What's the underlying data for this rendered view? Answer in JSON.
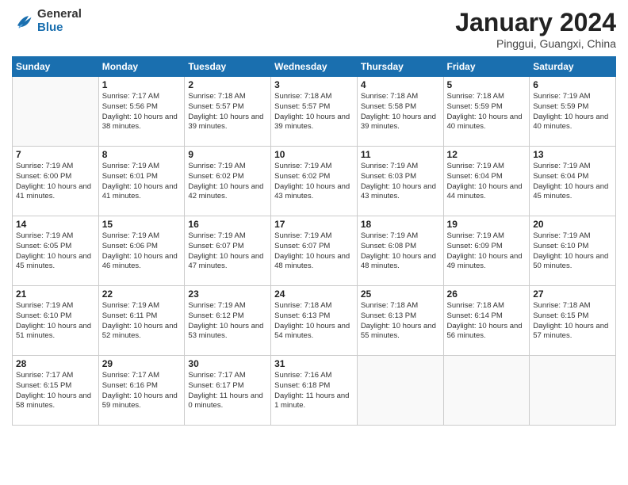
{
  "logo": {
    "general": "General",
    "blue": "Blue"
  },
  "title": {
    "month_year": "January 2024",
    "location": "Pinggui, Guangxi, China"
  },
  "weekdays": [
    "Sunday",
    "Monday",
    "Tuesday",
    "Wednesday",
    "Thursday",
    "Friday",
    "Saturday"
  ],
  "weeks": [
    [
      {
        "day": "",
        "info": ""
      },
      {
        "day": "1",
        "info": "Sunrise: 7:17 AM\nSunset: 5:56 PM\nDaylight: 10 hours\nand 38 minutes."
      },
      {
        "day": "2",
        "info": "Sunrise: 7:18 AM\nSunset: 5:57 PM\nDaylight: 10 hours\nand 39 minutes."
      },
      {
        "day": "3",
        "info": "Sunrise: 7:18 AM\nSunset: 5:57 PM\nDaylight: 10 hours\nand 39 minutes."
      },
      {
        "day": "4",
        "info": "Sunrise: 7:18 AM\nSunset: 5:58 PM\nDaylight: 10 hours\nand 39 minutes."
      },
      {
        "day": "5",
        "info": "Sunrise: 7:18 AM\nSunset: 5:59 PM\nDaylight: 10 hours\nand 40 minutes."
      },
      {
        "day": "6",
        "info": "Sunrise: 7:19 AM\nSunset: 5:59 PM\nDaylight: 10 hours\nand 40 minutes."
      }
    ],
    [
      {
        "day": "7",
        "info": "Sunrise: 7:19 AM\nSunset: 6:00 PM\nDaylight: 10 hours\nand 41 minutes."
      },
      {
        "day": "8",
        "info": "Sunrise: 7:19 AM\nSunset: 6:01 PM\nDaylight: 10 hours\nand 41 minutes."
      },
      {
        "day": "9",
        "info": "Sunrise: 7:19 AM\nSunset: 6:02 PM\nDaylight: 10 hours\nand 42 minutes."
      },
      {
        "day": "10",
        "info": "Sunrise: 7:19 AM\nSunset: 6:02 PM\nDaylight: 10 hours\nand 43 minutes."
      },
      {
        "day": "11",
        "info": "Sunrise: 7:19 AM\nSunset: 6:03 PM\nDaylight: 10 hours\nand 43 minutes."
      },
      {
        "day": "12",
        "info": "Sunrise: 7:19 AM\nSunset: 6:04 PM\nDaylight: 10 hours\nand 44 minutes."
      },
      {
        "day": "13",
        "info": "Sunrise: 7:19 AM\nSunset: 6:04 PM\nDaylight: 10 hours\nand 45 minutes."
      }
    ],
    [
      {
        "day": "14",
        "info": "Sunrise: 7:19 AM\nSunset: 6:05 PM\nDaylight: 10 hours\nand 45 minutes."
      },
      {
        "day": "15",
        "info": "Sunrise: 7:19 AM\nSunset: 6:06 PM\nDaylight: 10 hours\nand 46 minutes."
      },
      {
        "day": "16",
        "info": "Sunrise: 7:19 AM\nSunset: 6:07 PM\nDaylight: 10 hours\nand 47 minutes."
      },
      {
        "day": "17",
        "info": "Sunrise: 7:19 AM\nSunset: 6:07 PM\nDaylight: 10 hours\nand 48 minutes."
      },
      {
        "day": "18",
        "info": "Sunrise: 7:19 AM\nSunset: 6:08 PM\nDaylight: 10 hours\nand 48 minutes."
      },
      {
        "day": "19",
        "info": "Sunrise: 7:19 AM\nSunset: 6:09 PM\nDaylight: 10 hours\nand 49 minutes."
      },
      {
        "day": "20",
        "info": "Sunrise: 7:19 AM\nSunset: 6:10 PM\nDaylight: 10 hours\nand 50 minutes."
      }
    ],
    [
      {
        "day": "21",
        "info": "Sunrise: 7:19 AM\nSunset: 6:10 PM\nDaylight: 10 hours\nand 51 minutes."
      },
      {
        "day": "22",
        "info": "Sunrise: 7:19 AM\nSunset: 6:11 PM\nDaylight: 10 hours\nand 52 minutes."
      },
      {
        "day": "23",
        "info": "Sunrise: 7:19 AM\nSunset: 6:12 PM\nDaylight: 10 hours\nand 53 minutes."
      },
      {
        "day": "24",
        "info": "Sunrise: 7:18 AM\nSunset: 6:13 PM\nDaylight: 10 hours\nand 54 minutes."
      },
      {
        "day": "25",
        "info": "Sunrise: 7:18 AM\nSunset: 6:13 PM\nDaylight: 10 hours\nand 55 minutes."
      },
      {
        "day": "26",
        "info": "Sunrise: 7:18 AM\nSunset: 6:14 PM\nDaylight: 10 hours\nand 56 minutes."
      },
      {
        "day": "27",
        "info": "Sunrise: 7:18 AM\nSunset: 6:15 PM\nDaylight: 10 hours\nand 57 minutes."
      }
    ],
    [
      {
        "day": "28",
        "info": "Sunrise: 7:17 AM\nSunset: 6:15 PM\nDaylight: 10 hours\nand 58 minutes."
      },
      {
        "day": "29",
        "info": "Sunrise: 7:17 AM\nSunset: 6:16 PM\nDaylight: 10 hours\nand 59 minutes."
      },
      {
        "day": "30",
        "info": "Sunrise: 7:17 AM\nSunset: 6:17 PM\nDaylight: 11 hours\nand 0 minutes."
      },
      {
        "day": "31",
        "info": "Sunrise: 7:16 AM\nSunset: 6:18 PM\nDaylight: 11 hours\nand 1 minute."
      },
      {
        "day": "",
        "info": ""
      },
      {
        "day": "",
        "info": ""
      },
      {
        "day": "",
        "info": ""
      }
    ]
  ]
}
